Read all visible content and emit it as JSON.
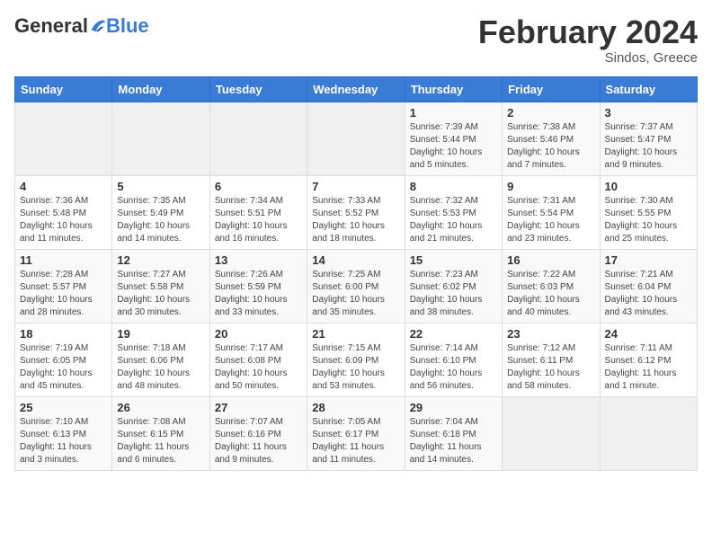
{
  "header": {
    "logo_general": "General",
    "logo_blue": "Blue",
    "month_year": "February 2024",
    "location": "Sindos, Greece"
  },
  "weekdays": [
    "Sunday",
    "Monday",
    "Tuesday",
    "Wednesday",
    "Thursday",
    "Friday",
    "Saturday"
  ],
  "weeks": [
    [
      {
        "day": "",
        "info": ""
      },
      {
        "day": "",
        "info": ""
      },
      {
        "day": "",
        "info": ""
      },
      {
        "day": "",
        "info": ""
      },
      {
        "day": "1",
        "info": "Sunrise: 7:39 AM\nSunset: 5:44 PM\nDaylight: 10 hours\nand 5 minutes."
      },
      {
        "day": "2",
        "info": "Sunrise: 7:38 AM\nSunset: 5:46 PM\nDaylight: 10 hours\nand 7 minutes."
      },
      {
        "day": "3",
        "info": "Sunrise: 7:37 AM\nSunset: 5:47 PM\nDaylight: 10 hours\nand 9 minutes."
      }
    ],
    [
      {
        "day": "4",
        "info": "Sunrise: 7:36 AM\nSunset: 5:48 PM\nDaylight: 10 hours\nand 11 minutes."
      },
      {
        "day": "5",
        "info": "Sunrise: 7:35 AM\nSunset: 5:49 PM\nDaylight: 10 hours\nand 14 minutes."
      },
      {
        "day": "6",
        "info": "Sunrise: 7:34 AM\nSunset: 5:51 PM\nDaylight: 10 hours\nand 16 minutes."
      },
      {
        "day": "7",
        "info": "Sunrise: 7:33 AM\nSunset: 5:52 PM\nDaylight: 10 hours\nand 18 minutes."
      },
      {
        "day": "8",
        "info": "Sunrise: 7:32 AM\nSunset: 5:53 PM\nDaylight: 10 hours\nand 21 minutes."
      },
      {
        "day": "9",
        "info": "Sunrise: 7:31 AM\nSunset: 5:54 PM\nDaylight: 10 hours\nand 23 minutes."
      },
      {
        "day": "10",
        "info": "Sunrise: 7:30 AM\nSunset: 5:55 PM\nDaylight: 10 hours\nand 25 minutes."
      }
    ],
    [
      {
        "day": "11",
        "info": "Sunrise: 7:28 AM\nSunset: 5:57 PM\nDaylight: 10 hours\nand 28 minutes."
      },
      {
        "day": "12",
        "info": "Sunrise: 7:27 AM\nSunset: 5:58 PM\nDaylight: 10 hours\nand 30 minutes."
      },
      {
        "day": "13",
        "info": "Sunrise: 7:26 AM\nSunset: 5:59 PM\nDaylight: 10 hours\nand 33 minutes."
      },
      {
        "day": "14",
        "info": "Sunrise: 7:25 AM\nSunset: 6:00 PM\nDaylight: 10 hours\nand 35 minutes."
      },
      {
        "day": "15",
        "info": "Sunrise: 7:23 AM\nSunset: 6:02 PM\nDaylight: 10 hours\nand 38 minutes."
      },
      {
        "day": "16",
        "info": "Sunrise: 7:22 AM\nSunset: 6:03 PM\nDaylight: 10 hours\nand 40 minutes."
      },
      {
        "day": "17",
        "info": "Sunrise: 7:21 AM\nSunset: 6:04 PM\nDaylight: 10 hours\nand 43 minutes."
      }
    ],
    [
      {
        "day": "18",
        "info": "Sunrise: 7:19 AM\nSunset: 6:05 PM\nDaylight: 10 hours\nand 45 minutes."
      },
      {
        "day": "19",
        "info": "Sunrise: 7:18 AM\nSunset: 6:06 PM\nDaylight: 10 hours\nand 48 minutes."
      },
      {
        "day": "20",
        "info": "Sunrise: 7:17 AM\nSunset: 6:08 PM\nDaylight: 10 hours\nand 50 minutes."
      },
      {
        "day": "21",
        "info": "Sunrise: 7:15 AM\nSunset: 6:09 PM\nDaylight: 10 hours\nand 53 minutes."
      },
      {
        "day": "22",
        "info": "Sunrise: 7:14 AM\nSunset: 6:10 PM\nDaylight: 10 hours\nand 56 minutes."
      },
      {
        "day": "23",
        "info": "Sunrise: 7:12 AM\nSunset: 6:11 PM\nDaylight: 10 hours\nand 58 minutes."
      },
      {
        "day": "24",
        "info": "Sunrise: 7:11 AM\nSunset: 6:12 PM\nDaylight: 11 hours\nand 1 minute."
      }
    ],
    [
      {
        "day": "25",
        "info": "Sunrise: 7:10 AM\nSunset: 6:13 PM\nDaylight: 11 hours\nand 3 minutes."
      },
      {
        "day": "26",
        "info": "Sunrise: 7:08 AM\nSunset: 6:15 PM\nDaylight: 11 hours\nand 6 minutes."
      },
      {
        "day": "27",
        "info": "Sunrise: 7:07 AM\nSunset: 6:16 PM\nDaylight: 11 hours\nand 9 minutes."
      },
      {
        "day": "28",
        "info": "Sunrise: 7:05 AM\nSunset: 6:17 PM\nDaylight: 11 hours\nand 11 minutes."
      },
      {
        "day": "29",
        "info": "Sunrise: 7:04 AM\nSunset: 6:18 PM\nDaylight: 11 hours\nand 14 minutes."
      },
      {
        "day": "",
        "info": ""
      },
      {
        "day": "",
        "info": ""
      }
    ]
  ]
}
